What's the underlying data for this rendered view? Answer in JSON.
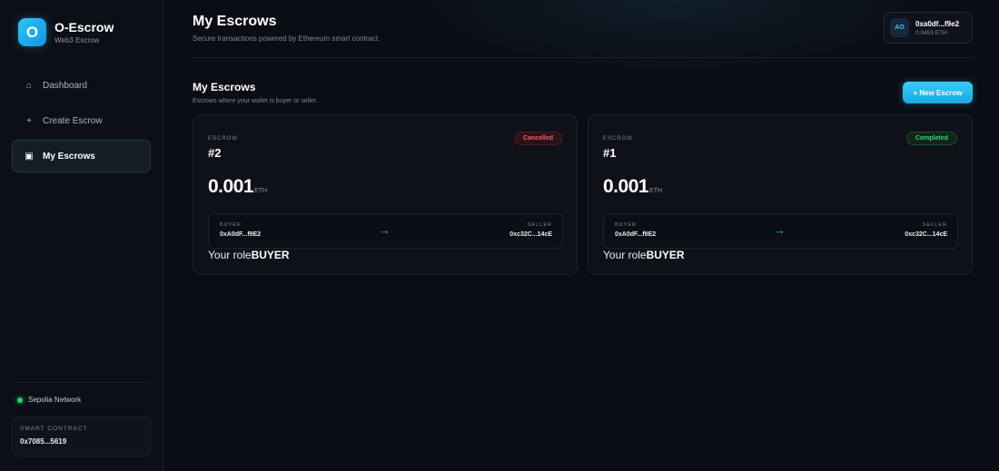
{
  "brand": {
    "logo_letter": "O",
    "name": "O-Escrow",
    "subtitle": "Web3 Escrow"
  },
  "nav": [
    {
      "icon": "home-icon",
      "glyph": "⌂",
      "label": "Dashboard",
      "active": false
    },
    {
      "icon": "plus-icon",
      "glyph": "+",
      "label": "Create Escrow",
      "active": false
    },
    {
      "icon": "list-icon",
      "glyph": "▣",
      "label": "My Escrows",
      "active": true
    }
  ],
  "network": {
    "label": "Sepolia Network",
    "status_color": "#22d36b"
  },
  "contract": {
    "label": "SMART CONTRACT",
    "address": "0x7085...5619"
  },
  "header": {
    "title": "My Escrows",
    "subtitle": "Secure transactions powered by Ethereum smart contract."
  },
  "wallet": {
    "avatar": "AO",
    "address": "0xa0df...f9e2",
    "balance": "0.0453 ETH"
  },
  "section": {
    "title": "My Escrows",
    "subtitle": "Escrows where your wallet is buyer or seller.",
    "new_button": "+ New Escrow"
  },
  "escrows": [
    {
      "label": "ESCROW",
      "id": "#2",
      "status": "Cancelled",
      "status_color": "#ff5c6e",
      "amount": "0.001",
      "unit": "ETH",
      "buyer_label": "BUYER",
      "buyer": "0xA0dF...f9E2",
      "arrow": "→",
      "seller_label": "SELLER",
      "seller": "0xc32C...14cE",
      "role_label": "Your role",
      "role": "BUYER"
    },
    {
      "label": "ESCROW",
      "id": "#1",
      "status": "Completed",
      "status_color": "#35d67a",
      "amount": "0.001",
      "unit": "ETH",
      "buyer_label": "BUYER",
      "buyer": "0xA0dF...f9E2",
      "arrow": "→",
      "seller_label": "SELLER",
      "seller": "0xc32C...14cE",
      "role_label": "Your role",
      "role": "BUYER"
    }
  ],
  "colors": {
    "accent": "#2bc4f5",
    "background": "#0b0d14"
  }
}
